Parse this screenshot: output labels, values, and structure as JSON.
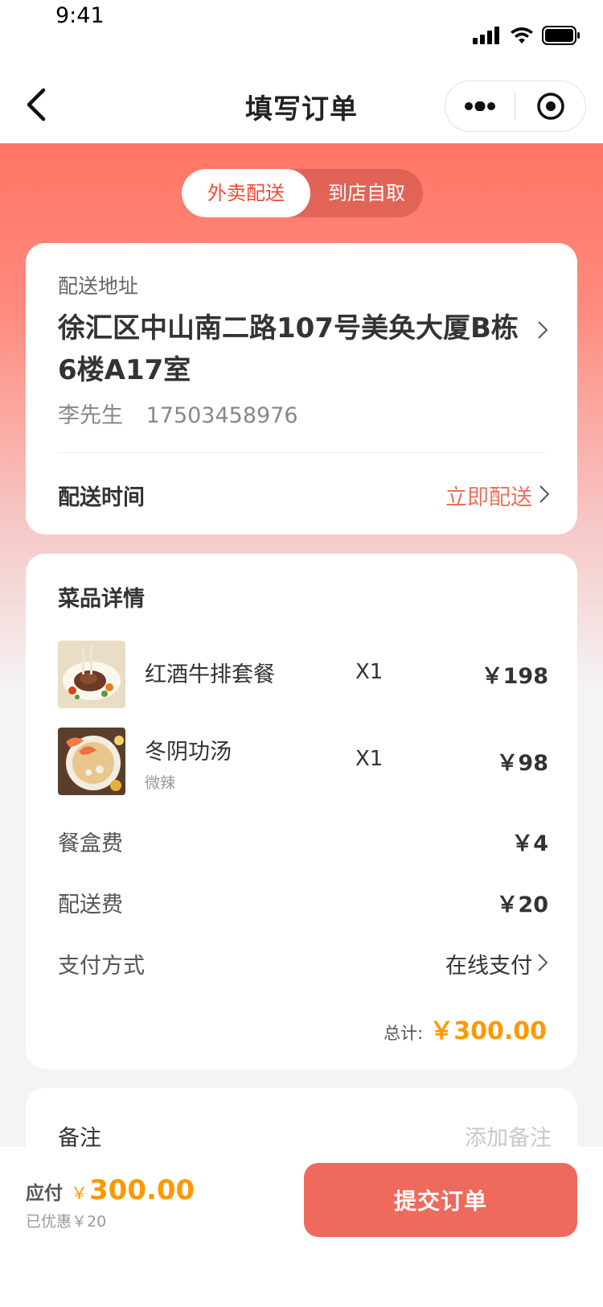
{
  "status_bar": {
    "time": "9:41"
  },
  "nav": {
    "title": "填写订单"
  },
  "delivery_mode": {
    "tabs": [
      "外卖配送",
      "到店自取"
    ],
    "active": "外卖配送"
  },
  "address": {
    "label": "配送地址",
    "text": "徐汇区中山南二路107号美奂大厦B栋6楼A17室",
    "name": "李先生",
    "phone": "17503458976"
  },
  "delivery_time": {
    "label": "配送时间",
    "value": "立即配送"
  },
  "dishes": {
    "title": "菜品详情",
    "items": [
      {
        "name": "红酒牛排套餐",
        "note": "",
        "qty": "X1",
        "price": "￥198"
      },
      {
        "name": "冬阴功汤",
        "note": "微辣",
        "qty": "X1",
        "price": "￥98"
      }
    ]
  },
  "fees": {
    "box": {
      "label": "餐盒费",
      "value": "￥4"
    },
    "delivery": {
      "label": "配送费",
      "value": "￥20"
    },
    "payment": {
      "label": "支付方式",
      "value": "在线支付"
    }
  },
  "total": {
    "label": "总计:",
    "value": "￥300.00"
  },
  "remark": {
    "label": "备注",
    "placeholder": "添加备注"
  },
  "bottom": {
    "pay_label": "应付",
    "currency": "￥",
    "amount": "300.00",
    "discount": "已优惠￥20",
    "submit": "提交订单"
  },
  "colors": {
    "accent": "#ee6a5c",
    "price": "#ff9800",
    "link": "#ee6f5e"
  }
}
